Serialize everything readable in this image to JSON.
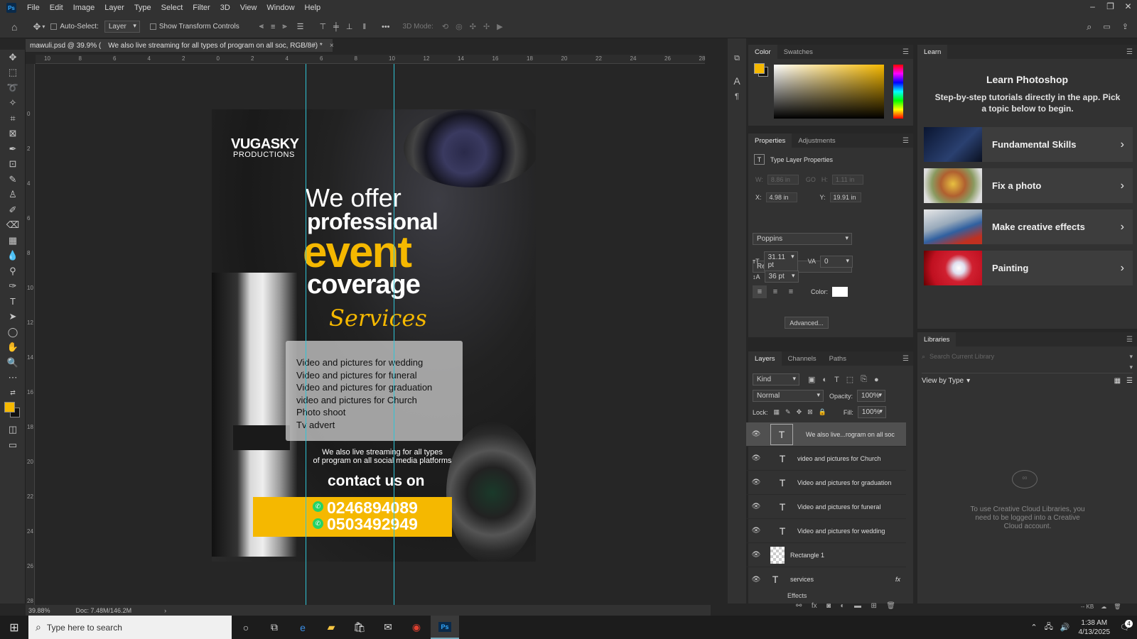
{
  "menu": {
    "items": [
      "File",
      "Edit",
      "Image",
      "Layer",
      "Type",
      "Select",
      "Filter",
      "3D",
      "View",
      "Window",
      "Help"
    ]
  },
  "options": {
    "auto_select": "Auto-Select:",
    "layer_select": "Layer",
    "transform": "Show Transform Controls",
    "mode3d": "3D Mode:"
  },
  "doc": {
    "tab_prefix": "mawuli.psd @ 39.9% (",
    "tab_title": "We also live streaming for all types of program on all soc, RGB/8#) *",
    "close": "×"
  },
  "ruler": {
    "h": [
      "10",
      "8",
      "6",
      "4",
      "2",
      "0",
      "2",
      "4",
      "6",
      "8",
      "10",
      "12",
      "14",
      "16",
      "18",
      "20",
      "22",
      "24",
      "26",
      "28"
    ],
    "v": [
      "0",
      "2",
      "4",
      "6",
      "8",
      "10",
      "12",
      "14",
      "16",
      "18",
      "20",
      "22",
      "24",
      "26",
      "28"
    ]
  },
  "poster": {
    "brand1": "VUGASKY",
    "brand2": "PRODUCTIONS",
    "l1": "We offer",
    "l2": "professional",
    "l3": "event",
    "l4": "coverage",
    "l5": "Services",
    "services": [
      "Video and pictures for wedding",
      "Video and pictures for funeral",
      "Video and pictures for graduation",
      "video and pictures for Church",
      "Photo shoot",
      "Tv advert"
    ],
    "stream1": "We also live streaming for all types",
    "stream2": "of program on all social media platforms",
    "contact": "contact us on",
    "phone1": "0246894089",
    "phone2": "0503492949"
  },
  "status": {
    "zoom": "39.88%",
    "doc": "Doc: 7.48M/146.2M"
  },
  "color": {
    "tabs": [
      "Color",
      "Swatches"
    ],
    "fg": "#f5b800"
  },
  "props": {
    "tabs": [
      "Properties",
      "Adjustments"
    ],
    "title": "Type Layer Properties",
    "w_label": "W:",
    "w": "8.86 in",
    "go": "GO",
    "h_label": "H:",
    "h": "1.11 in",
    "x_label": "X:",
    "x": "4.98 in",
    "y_label": "Y:",
    "y": "19.91 in",
    "font": "Poppins",
    "style": "Regular",
    "size": "31.11 pt",
    "tracking": "0",
    "leading": "36 pt",
    "color_label": "Color:",
    "advanced": "Advanced..."
  },
  "layers": {
    "tabs": [
      "Layers",
      "Channels",
      "Paths"
    ],
    "kind": "Kind",
    "blend": "Normal",
    "opacity_label": "Opacity:",
    "opacity": "100%",
    "lock_label": "Lock:",
    "fill_label": "Fill:",
    "fill": "100%",
    "rows": [
      {
        "name": "We also live...rogram on all soc",
        "type": "T"
      },
      {
        "name": "video and pictures for Church",
        "type": "T"
      },
      {
        "name": "Video and pictures for graduation",
        "type": "T"
      },
      {
        "name": "Video and pictures for funeral",
        "type": "T"
      },
      {
        "name": "Video and pictures for wedding",
        "type": "T"
      },
      {
        "name": "Rectangle 1",
        "type": "R"
      },
      {
        "name": "services",
        "type": "T"
      }
    ],
    "effects": "Effects",
    "fx": "fx"
  },
  "learn": {
    "tab": "Learn",
    "title": "Learn Photoshop",
    "subtitle": "Step-by-step tutorials directly in the app. Pick a topic below to begin.",
    "cards": [
      "Fundamental Skills",
      "Fix a photo",
      "Make creative effects",
      "Painting"
    ]
  },
  "libraries": {
    "tab": "Libraries",
    "search_placeholder": "Search Current Library",
    "view": "View by Type",
    "msg": "To use Creative Cloud Libraries, you need to be logged into a Creative Cloud account.",
    "kb": "-- KB"
  },
  "taskbar": {
    "search": "Type here to search",
    "time": "1:38 AM",
    "date": "4/13/2025",
    "notif": "4"
  }
}
